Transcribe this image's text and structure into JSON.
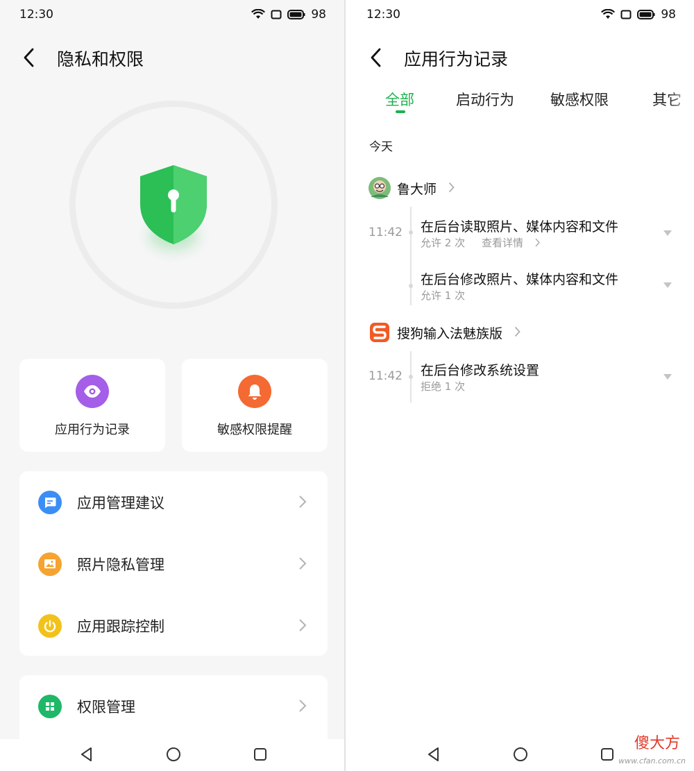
{
  "left": {
    "status": {
      "time": "12:30",
      "battery": "98"
    },
    "title": "隐私和权限",
    "quick_cards": [
      {
        "label": "应用行为记录",
        "color": "#a45ee8",
        "icon": "eye-icon"
      },
      {
        "label": "敏感权限提醒",
        "color": "#f46a32",
        "icon": "bell-icon"
      }
    ],
    "menu": [
      {
        "label": "应用管理建议",
        "color": "#3b8ef5",
        "icon": "message-icon"
      },
      {
        "label": "照片隐私管理",
        "color": "#f5a331",
        "icon": "image-icon"
      },
      {
        "label": "应用跟踪控制",
        "color": "#f3c21a",
        "icon": "power-icon"
      }
    ],
    "menu2": [
      {
        "label": "权限管理",
        "color": "#1fb868",
        "icon": "grid-icon"
      }
    ]
  },
  "right": {
    "status": {
      "time": "12:30",
      "battery": "98"
    },
    "title": "应用行为记录",
    "tabs": [
      "全部",
      "启动行为",
      "敏感权限",
      "其它"
    ],
    "active_tab": "全部",
    "section": "今天",
    "apps": [
      {
        "name": "鲁大师",
        "events": [
          {
            "time": "11:42",
            "title": "在后台读取照片、媒体内容和文件",
            "count": "允许 2 次",
            "detail": "查看详情"
          },
          {
            "time": "",
            "title": "在后台修改照片、媒体内容和文件",
            "count": "允许 1 次",
            "detail": ""
          }
        ]
      },
      {
        "name": "搜狗输入法魅族版",
        "events": [
          {
            "time": "11:42",
            "title": "在后台修改系统设置",
            "count": "拒绝 1 次",
            "detail": ""
          }
        ]
      }
    ],
    "watermark": "傻大方",
    "watermark_url": "www.cfan.com.cn"
  },
  "colors": {
    "accent": "#1fb14e",
    "shield": "#2bbf55"
  }
}
